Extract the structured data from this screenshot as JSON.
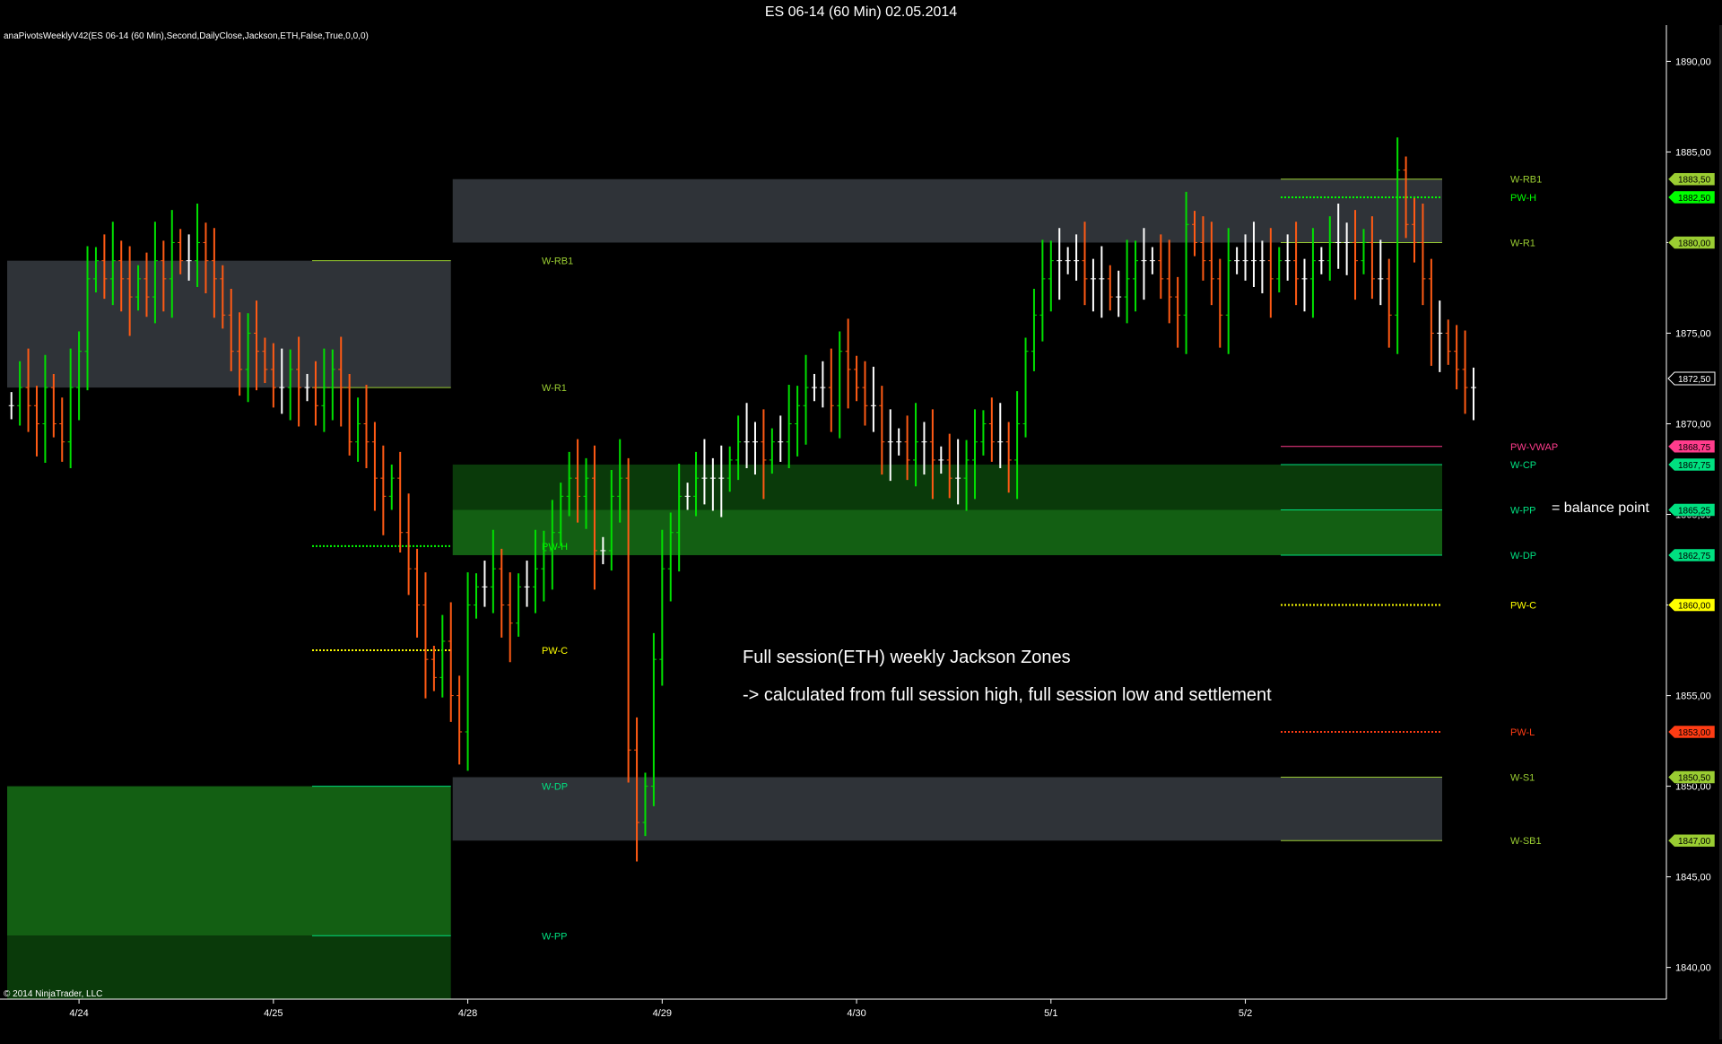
{
  "window": {
    "title": "ES 06-14 (60 Min)  02.05.2014",
    "indicator_label": "anaPivotsWeeklyV42(ES 06-14 (60 Min),Second,DailyClose,Jackson,ETH,False,True,0,0,0)",
    "copyright": "© 2014 NinjaTrader, LLC"
  },
  "colors": {
    "background": "#000000",
    "up_bar": "#00e000",
    "down_bar": "#ff5a14",
    "neutral_bar": "#ffffff",
    "zone_gray": "#2f3338",
    "zone_green": "#135f13",
    "zone_dark_green": "#0a3a0a",
    "axis_text": "#ffffff"
  },
  "annotations": {
    "main_line1": "Full session(ETH) weekly Jackson Zones",
    "main_line2": "-> calculated from full session high, full session low and settlement",
    "balance": "= balance point"
  },
  "chart_data": {
    "type": "candlestick",
    "ylim": [
      1838.25,
      1892.0
    ],
    "y_ticks": [
      "1890,00",
      "1885,00",
      "1880,00",
      "1875,00",
      "1870,00",
      "1865,00",
      "1860,00",
      "1855,00",
      "1850,00",
      "1845,00",
      "1840,00"
    ],
    "y_tick_values": [
      1890,
      1885,
      1880,
      1875,
      1870,
      1865,
      1860,
      1855,
      1850,
      1845,
      1840
    ],
    "x_labels": [
      "4/24",
      "4/25",
      "4/28",
      "4/29",
      "4/30",
      "5/1",
      "5/2"
    ],
    "x_label_bars": [
      8,
      31,
      54,
      77,
      100,
      123,
      146
    ],
    "bar_count": 170,
    "current_week_levels": [
      {
        "label": "W-RB1",
        "value": 1883.5,
        "color": "#9acd32",
        "style": "solid",
        "tag": "1883,50"
      },
      {
        "label": "PW-H",
        "value": 1882.5,
        "color": "#00ff00",
        "style": "dotted",
        "tag": "1882,50"
      },
      {
        "label": "W-R1",
        "value": 1880.0,
        "color": "#9acd32",
        "style": "solid",
        "tag": "1880,00"
      },
      {
        "label": "PW-VWAP",
        "value": 1868.75,
        "color": "#ff3c8c",
        "style": "solid",
        "tag": "1868,75"
      },
      {
        "label": "W-CP",
        "value": 1867.75,
        "color": "#00e080",
        "style": "solid",
        "tag": "1867,75"
      },
      {
        "label": "W-PP",
        "value": 1865.25,
        "color": "#00e080",
        "style": "solid",
        "tag": "1865,25"
      },
      {
        "label": "W-DP",
        "value": 1862.75,
        "color": "#00e080",
        "style": "solid",
        "tag": "1862,75"
      },
      {
        "label": "PW-C",
        "value": 1860.0,
        "color": "#ffff00",
        "style": "dotted",
        "tag": "1860,00"
      },
      {
        "label": "PW-L",
        "value": 1853.0,
        "color": "#ff3c14",
        "style": "dotted",
        "tag": "1853,00"
      },
      {
        "label": "W-S1",
        "value": 1850.5,
        "color": "#9acd32",
        "style": "solid",
        "tag": "1850,50"
      },
      {
        "label": "W-SB1",
        "value": 1847.0,
        "color": "#9acd32",
        "style": "solid",
        "tag": "1847,00"
      }
    ],
    "last_price_tag": "1872,50",
    "last_price": 1872.5,
    "prior_week_levels": [
      {
        "label": "W-RB1",
        "value": 1879.0,
        "color": "#9acd32",
        "style": "solid"
      },
      {
        "label": "W-R1",
        "value": 1872.0,
        "color": "#9acd32",
        "style": "solid"
      },
      {
        "label": "PW-H",
        "value": 1863.25,
        "color": "#00ff00",
        "style": "dotted"
      },
      {
        "label": "PW-C",
        "value": 1857.5,
        "color": "#ffff00",
        "style": "dotted"
      },
      {
        "label": "W-DP",
        "value": 1850.0,
        "color": "#00e080",
        "style": "solid"
      },
      {
        "label": "W-PP",
        "value": 1841.75,
        "color": "#00e080",
        "style": "solid"
      }
    ],
    "zones_prior_week": [
      {
        "y0": 1872.0,
        "y1": 1879.0,
        "color": "gray"
      },
      {
        "y0": 1841.75,
        "y1": 1850.0,
        "color": "green"
      },
      {
        "y0": 1838.25,
        "y1": 1841.75,
        "color": "dark_green"
      }
    ],
    "zones_current_week": [
      {
        "y0": 1880.0,
        "y1": 1883.5,
        "color": "gray"
      },
      {
        "y0": 1865.25,
        "y1": 1867.75,
        "color": "dark_green"
      },
      {
        "y0": 1862.75,
        "y1": 1865.25,
        "color": "green"
      },
      {
        "y0": 1847.0,
        "y1": 1850.5,
        "color": "gray"
      }
    ],
    "closes": [
      1871,
      1872,
      1871,
      1870,
      1872,
      1870,
      1869,
      1872,
      1874,
      1878,
      1879,
      1878,
      1879,
      1878,
      1877,
      1878,
      1877,
      1879,
      1878,
      1880,
      1879,
      1879,
      1880,
      1879,
      1878,
      1876,
      1874,
      1873,
      1875,
      1874,
      1873,
      1872,
      1872,
      1873,
      1872,
      1872,
      1871,
      1872,
      1873,
      1872,
      1869,
      1870,
      1869,
      1867,
      1866,
      1867,
      1864,
      1862,
      1860,
      1857,
      1856,
      1858,
      1855,
      1853,
      1860,
      1861,
      1861,
      1862,
      1860,
      1859,
      1861,
      1861,
      1862,
      1863,
      1864,
      1866,
      1867,
      1866,
      1867,
      1863,
      1863,
      1866,
      1867,
      1852,
      1848,
      1850,
      1857,
      1862,
      1864,
      1866,
      1866,
      1867,
      1867,
      1867,
      1867,
      1868,
      1869,
      1869,
      1869,
      1868,
      1869,
      1869,
      1870,
      1871,
      1872,
      1872,
      1872,
      1871,
      1874,
      1873,
      1872,
      1871,
      1871,
      1869,
      1869,
      1869,
      1868,
      1869,
      1869,
      1868,
      1868,
      1867,
      1867,
      1868,
      1869,
      1870,
      1869,
      1869,
      1868,
      1870,
      1874,
      1876,
      1878,
      1879,
      1879,
      1879,
      1879,
      1878,
      1878,
      1878,
      1877,
      1877,
      1878,
      1879,
      1879,
      1879,
      1878,
      1877,
      1876,
      1881,
      1880,
      1879,
      1878,
      1876,
      1879,
      1879,
      1879,
      1879,
      1879,
      1878,
      1879,
      1879,
      1878,
      1878,
      1879,
      1879,
      1880,
      1880,
      1880,
      1879,
      1880,
      1878,
      1878,
      1876,
      1884,
      1881,
      1880,
      1878,
      1875,
      1875,
      1874,
      1873,
      1872,
      1872
    ]
  }
}
